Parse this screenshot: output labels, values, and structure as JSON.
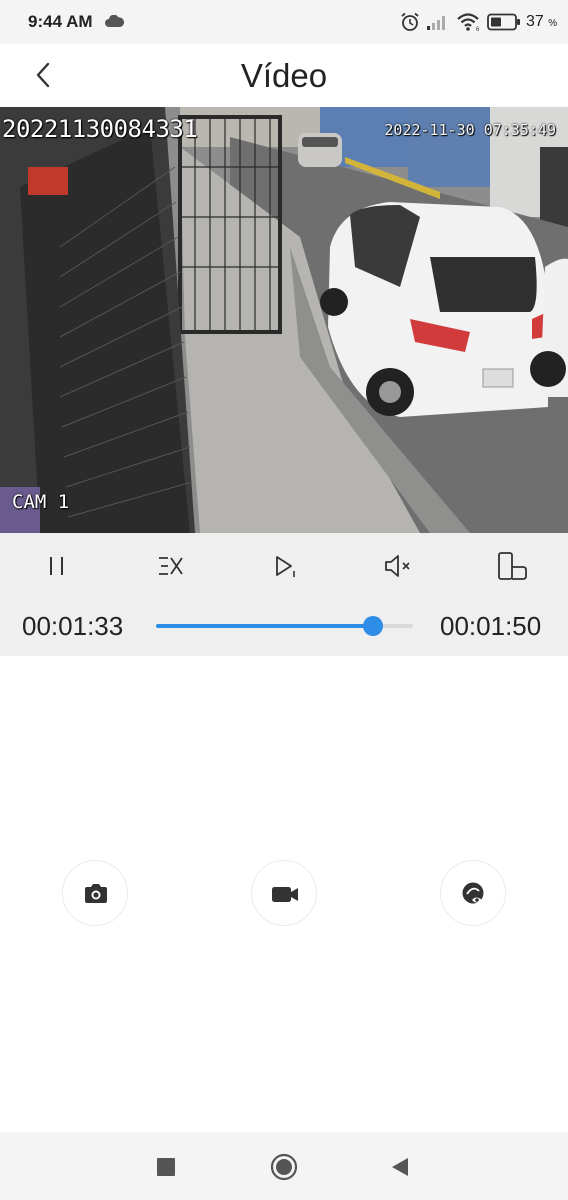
{
  "status_bar": {
    "time": "9:44 AM",
    "battery_percent": "37",
    "battery_unit": "%",
    "icons": [
      "cloud-icon",
      "alarm-icon",
      "signal-icon",
      "wifi-icon",
      "battery-icon"
    ]
  },
  "header": {
    "title": "Vídeo",
    "back_icon": "chevron-left-icon"
  },
  "video": {
    "osd_id": "20221130084331",
    "osd_timestamp": "2022-11-30 07:35:49",
    "camera_label": "CAM 1"
  },
  "playback": {
    "current_time": "00:01:33",
    "total_time": "00:01:50",
    "progress": 0.845,
    "accent_color": "#2e8de6",
    "controls": [
      "pause-icon",
      "speed-icon",
      "frame-step-icon",
      "mute-icon",
      "rotate-screen-icon"
    ]
  },
  "actions": {
    "buttons": [
      "camera-icon",
      "video-record-icon",
      "face-eye-icon"
    ]
  },
  "nav_bar": {
    "buttons": [
      "recents-square-icon",
      "home-circle-icon",
      "back-triangle-icon"
    ]
  }
}
